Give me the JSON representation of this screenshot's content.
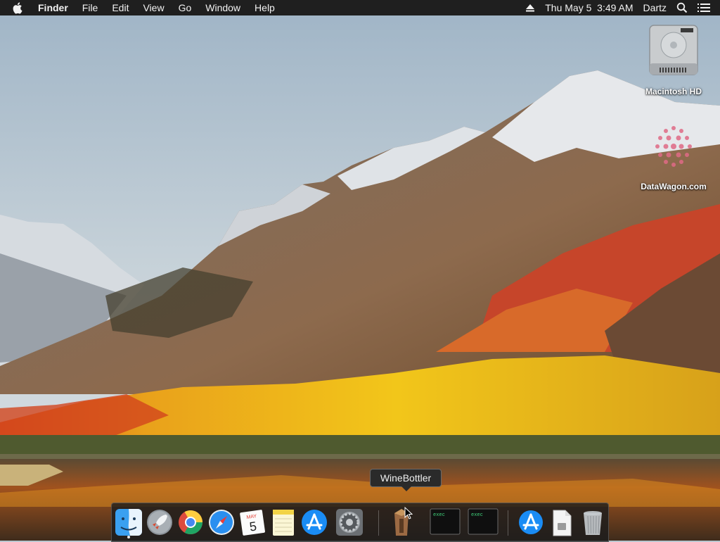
{
  "menubar": {
    "apple_icon": "apple-logo-icon",
    "app_name": "Finder",
    "menus": [
      "File",
      "Edit",
      "View",
      "Go",
      "Window",
      "Help"
    ],
    "eject_icon": "eject-icon",
    "datetime": "Thu May 5  3:49 AM",
    "user": "Dartz",
    "spotlight_icon": "search-icon",
    "notification_icon": "list-icon"
  },
  "desktop": {
    "icons": [
      {
        "label": "Macintosh HD",
        "icon": "hard-drive-icon"
      },
      {
        "label": "DataWagon.com",
        "icon": "datawagon-logo-icon"
      }
    ]
  },
  "tooltip": {
    "text": "WineBottler"
  },
  "dock": {
    "items": [
      {
        "name": "Finder",
        "icon": "finder-icon",
        "running": true
      },
      {
        "name": "Launchpad",
        "icon": "rocket-icon"
      },
      {
        "name": "Google Chrome",
        "icon": "chrome-icon"
      },
      {
        "name": "Safari",
        "icon": "compass-icon"
      },
      {
        "name": "Calendar",
        "icon": "calendar-icon",
        "month": "MAY",
        "day": "5"
      },
      {
        "name": "Notes",
        "icon": "notes-icon"
      },
      {
        "name": "App Store",
        "icon": "app-store-icon"
      },
      {
        "name": "System Preferences",
        "icon": "gear-icon"
      },
      {
        "name": "WineBottler",
        "icon": "wine-bottle-icon"
      },
      {
        "name": "exec",
        "icon": "terminal-icon",
        "label": "exec"
      },
      {
        "name": "exec",
        "icon": "terminal-icon",
        "label": "exec"
      },
      {
        "name": "Applications",
        "icon": "app-store-icon"
      },
      {
        "name": "Downloads",
        "icon": "document-icon"
      },
      {
        "name": "Trash",
        "icon": "trash-icon"
      }
    ]
  },
  "colors": {
    "menubar_bg": "#1f1f1f",
    "dock_bg": "#1c1c1c",
    "tooltip_bg": "#2a2a2a"
  }
}
